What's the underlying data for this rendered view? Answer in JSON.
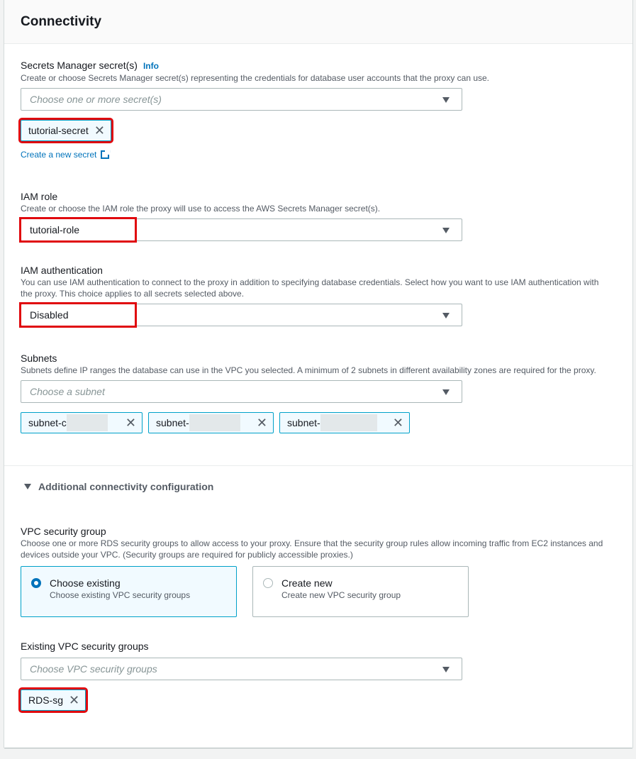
{
  "panel": {
    "title": "Connectivity"
  },
  "secrets": {
    "label": "Secrets Manager secret(s)",
    "info": "Info",
    "description": "Create or choose Secrets Manager secret(s) representing the credentials for database user accounts that the proxy can use.",
    "placeholder": "Choose one or more secret(s)",
    "selected": [
      "tutorial-secret"
    ],
    "create_link": "Create a new secret"
  },
  "iam_role": {
    "label": "IAM role",
    "description": "Create or choose the IAM role the proxy will use to access the AWS Secrets Manager secret(s).",
    "value": "tutorial-role"
  },
  "iam_auth": {
    "label": "IAM authentication",
    "description": "You can use IAM authentication to connect to the proxy in addition to specifying database credentials. Select how you want to use IAM authentication with the proxy. This choice applies to all secrets selected above.",
    "value": "Disabled"
  },
  "subnets": {
    "label": "Subnets",
    "description": "Subnets define IP ranges the database can use in the VPC you selected. A minimum of 2 subnets in different availability zones are required for the proxy.",
    "placeholder": "Choose a subnet",
    "selected": [
      "subnet-c",
      "subnet-",
      "subnet-"
    ]
  },
  "additional": {
    "label": "Additional connectivity configuration",
    "expanded": true
  },
  "vpc_sg": {
    "label": "VPC security group",
    "description": "Choose one or more RDS security groups to allow access to your proxy. Ensure that the security group rules allow incoming traffic from EC2 instances and devices outside your VPC. (Security groups are required for publicly accessible proxies.)",
    "options": [
      {
        "title": "Choose existing",
        "desc": "Choose existing VPC security groups",
        "selected": true
      },
      {
        "title": "Create new",
        "desc": "Create new VPC security group",
        "selected": false
      }
    ]
  },
  "existing_sg": {
    "label": "Existing VPC security groups",
    "placeholder": "Choose VPC security groups",
    "selected": [
      "RDS-sg"
    ]
  },
  "colors": {
    "accent": "#0073bb",
    "chip_border": "#00a1c9",
    "highlight": "#e0080e"
  }
}
